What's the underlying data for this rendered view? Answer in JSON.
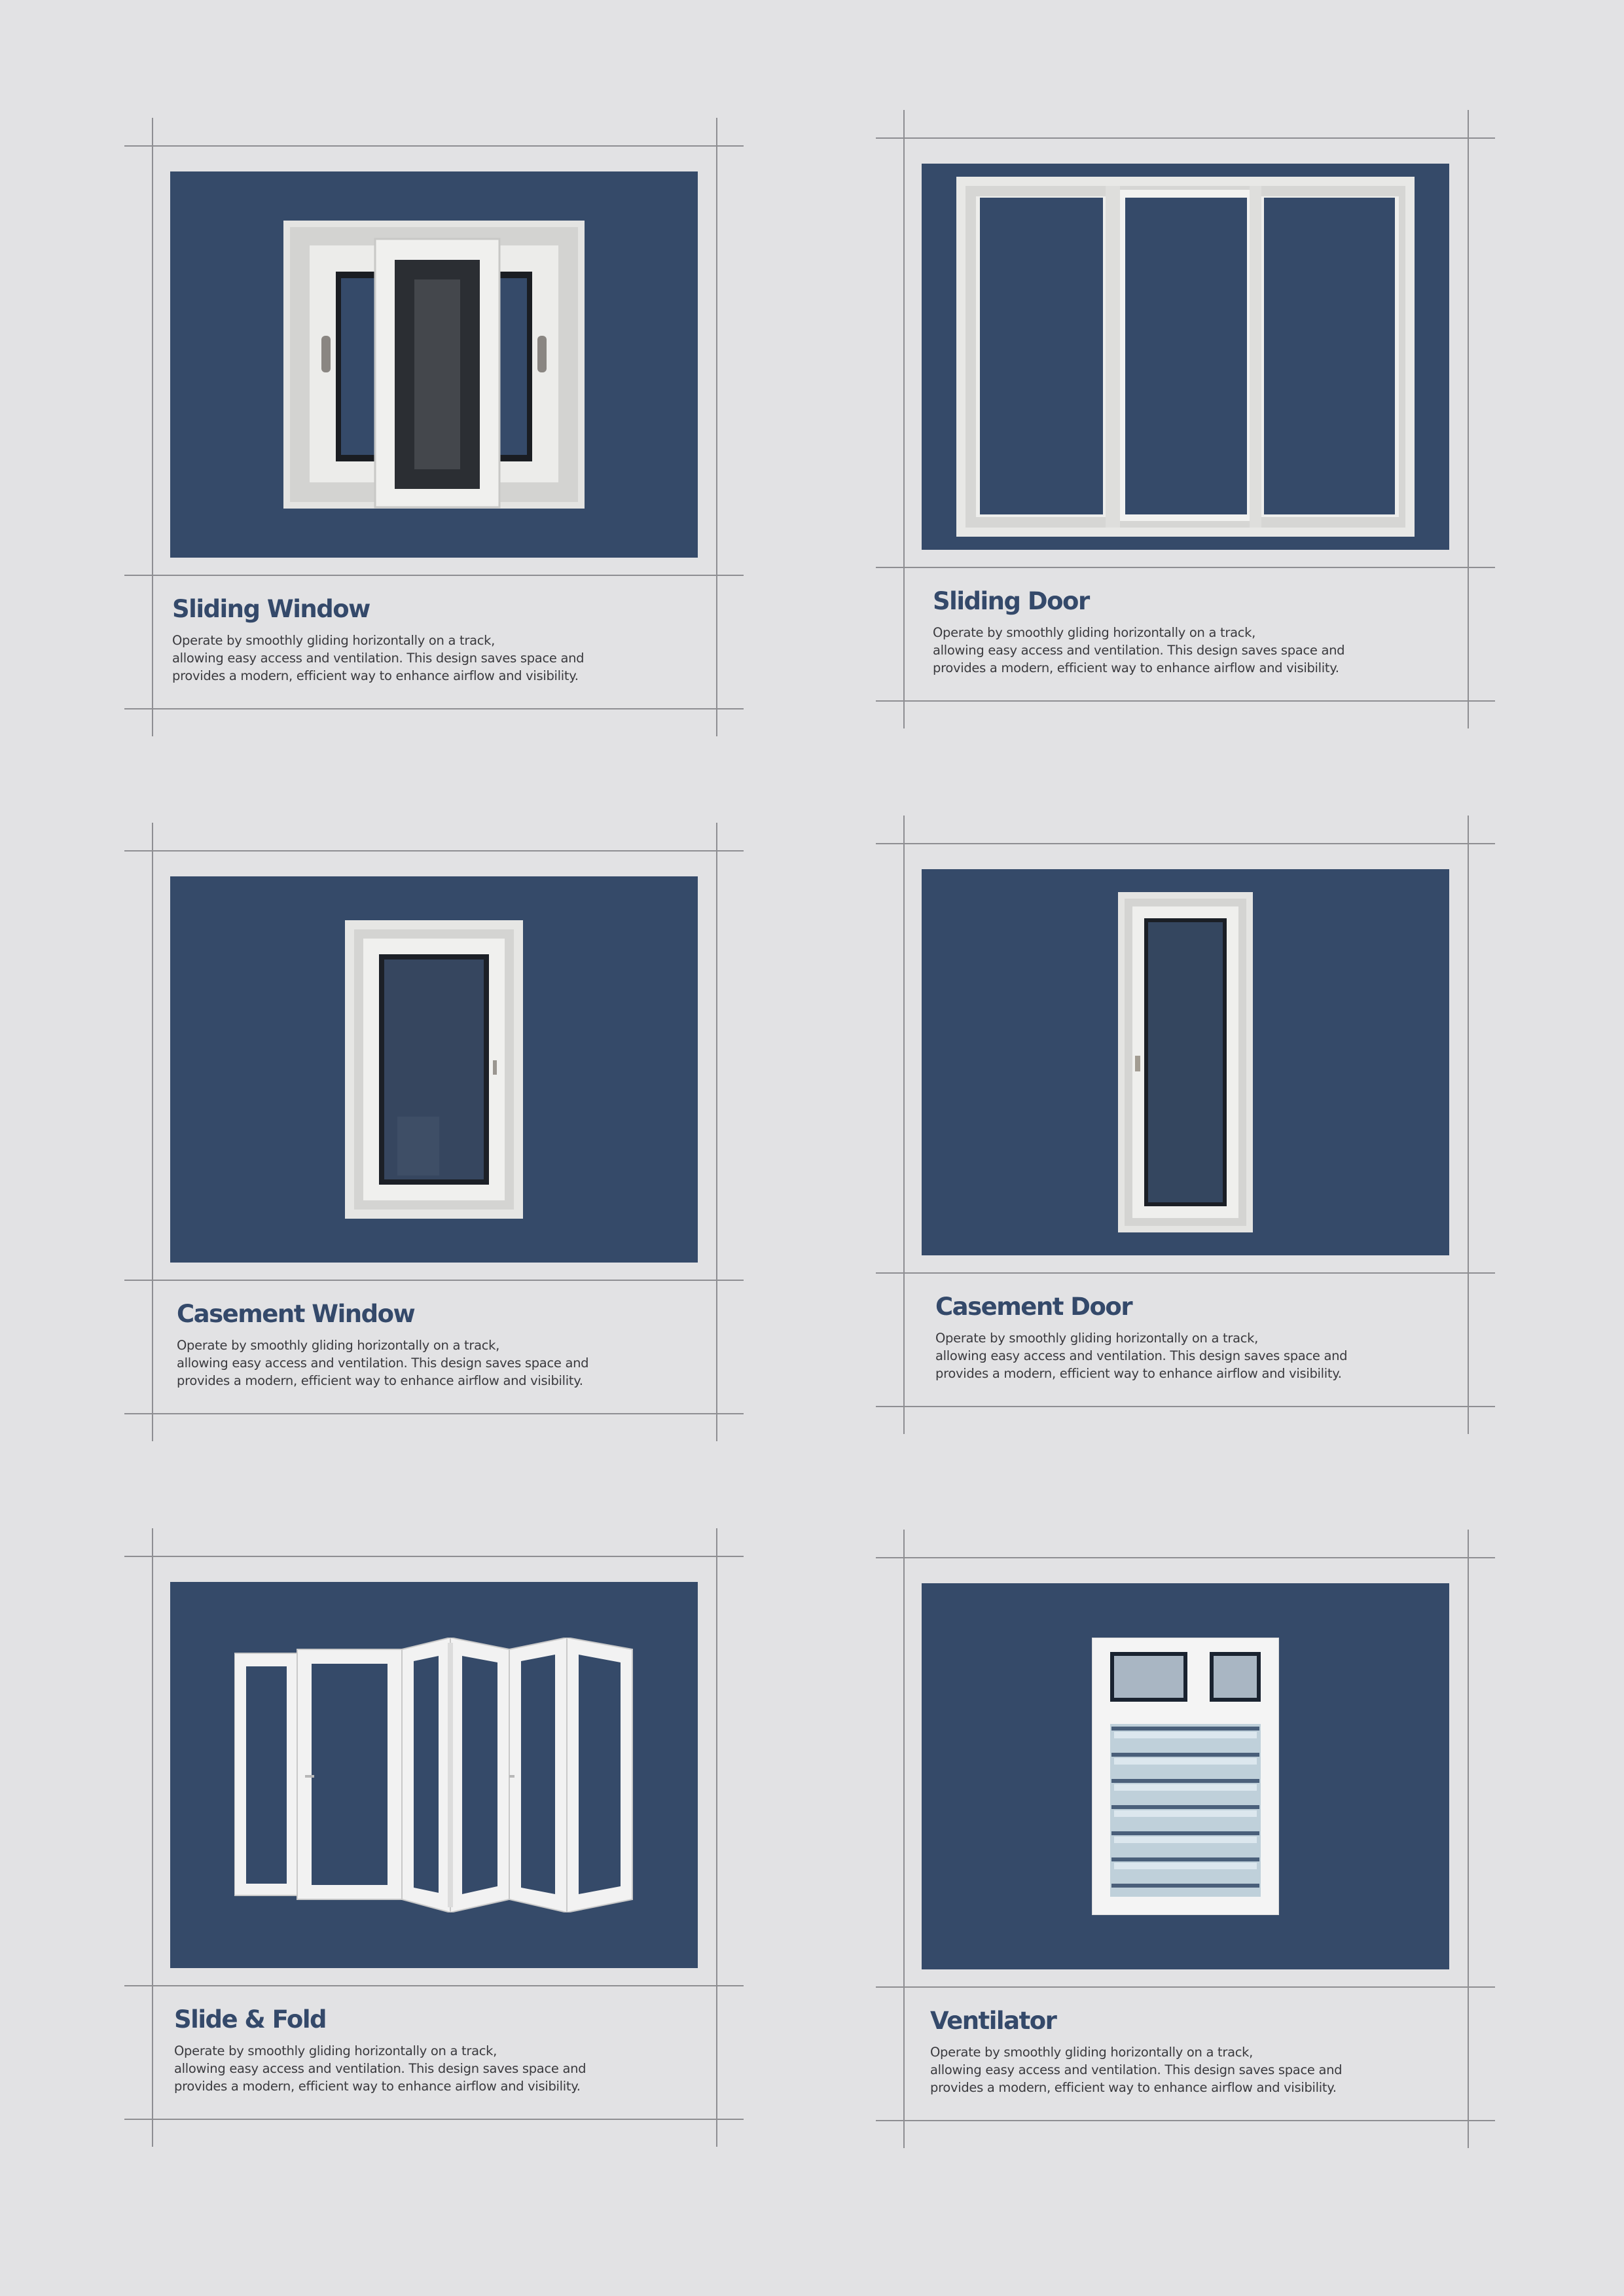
{
  "products": [
    {
      "title": "Sliding Window",
      "description": [
        "Operate by smoothly gliding horizontally on a track,",
        "allowing easy access and ventilation. This design saves space and",
        "provides a modern, efficient way to enhance airflow and visibility."
      ],
      "image": "sliding-window-illustration"
    },
    {
      "title": "Sliding Door",
      "description": [
        "Operate by smoothly gliding horizontally on a track,",
        "allowing easy access and ventilation. This design saves space and",
        "provides a modern, efficient way to enhance airflow and visibility."
      ],
      "image": "sliding-door-illustration"
    },
    {
      "title": "Casement Window",
      "description": [
        "Operate by smoothly gliding horizontally on a track,",
        "allowing easy access and ventilation. This design saves space and",
        "provides a modern, efficient way to enhance airflow and visibility."
      ],
      "image": "casement-window-illustration"
    },
    {
      "title": "Casement Door",
      "description": [
        "Operate by smoothly gliding horizontally on a track,",
        "allowing easy access and ventilation. This design saves space and",
        "provides a modern, efficient way to enhance airflow and visibility."
      ],
      "image": "casement-door-illustration"
    },
    {
      "title": "Slide & Fold",
      "description": [
        "Operate by smoothly gliding horizontally on a track,",
        "allowing easy access and ventilation. This design saves space and",
        "provides a modern, efficient way to enhance airflow and visibility."
      ],
      "image": "slide-and-fold-illustration"
    },
    {
      "title": "Ventilator",
      "description": [
        "Operate by smoothly gliding horizontally on a track,",
        "allowing easy access and ventilation. This design saves space and",
        "provides a modern, efficient way to enhance airflow and visibility."
      ],
      "image": "ventilator-illustration"
    }
  ],
  "colors": {
    "page_background": "#e2e2e4",
    "panel_background": "#354a69",
    "title_color": "#34496a",
    "text_color": "#3a3a3e",
    "guide_lines": "#8e8e92"
  }
}
